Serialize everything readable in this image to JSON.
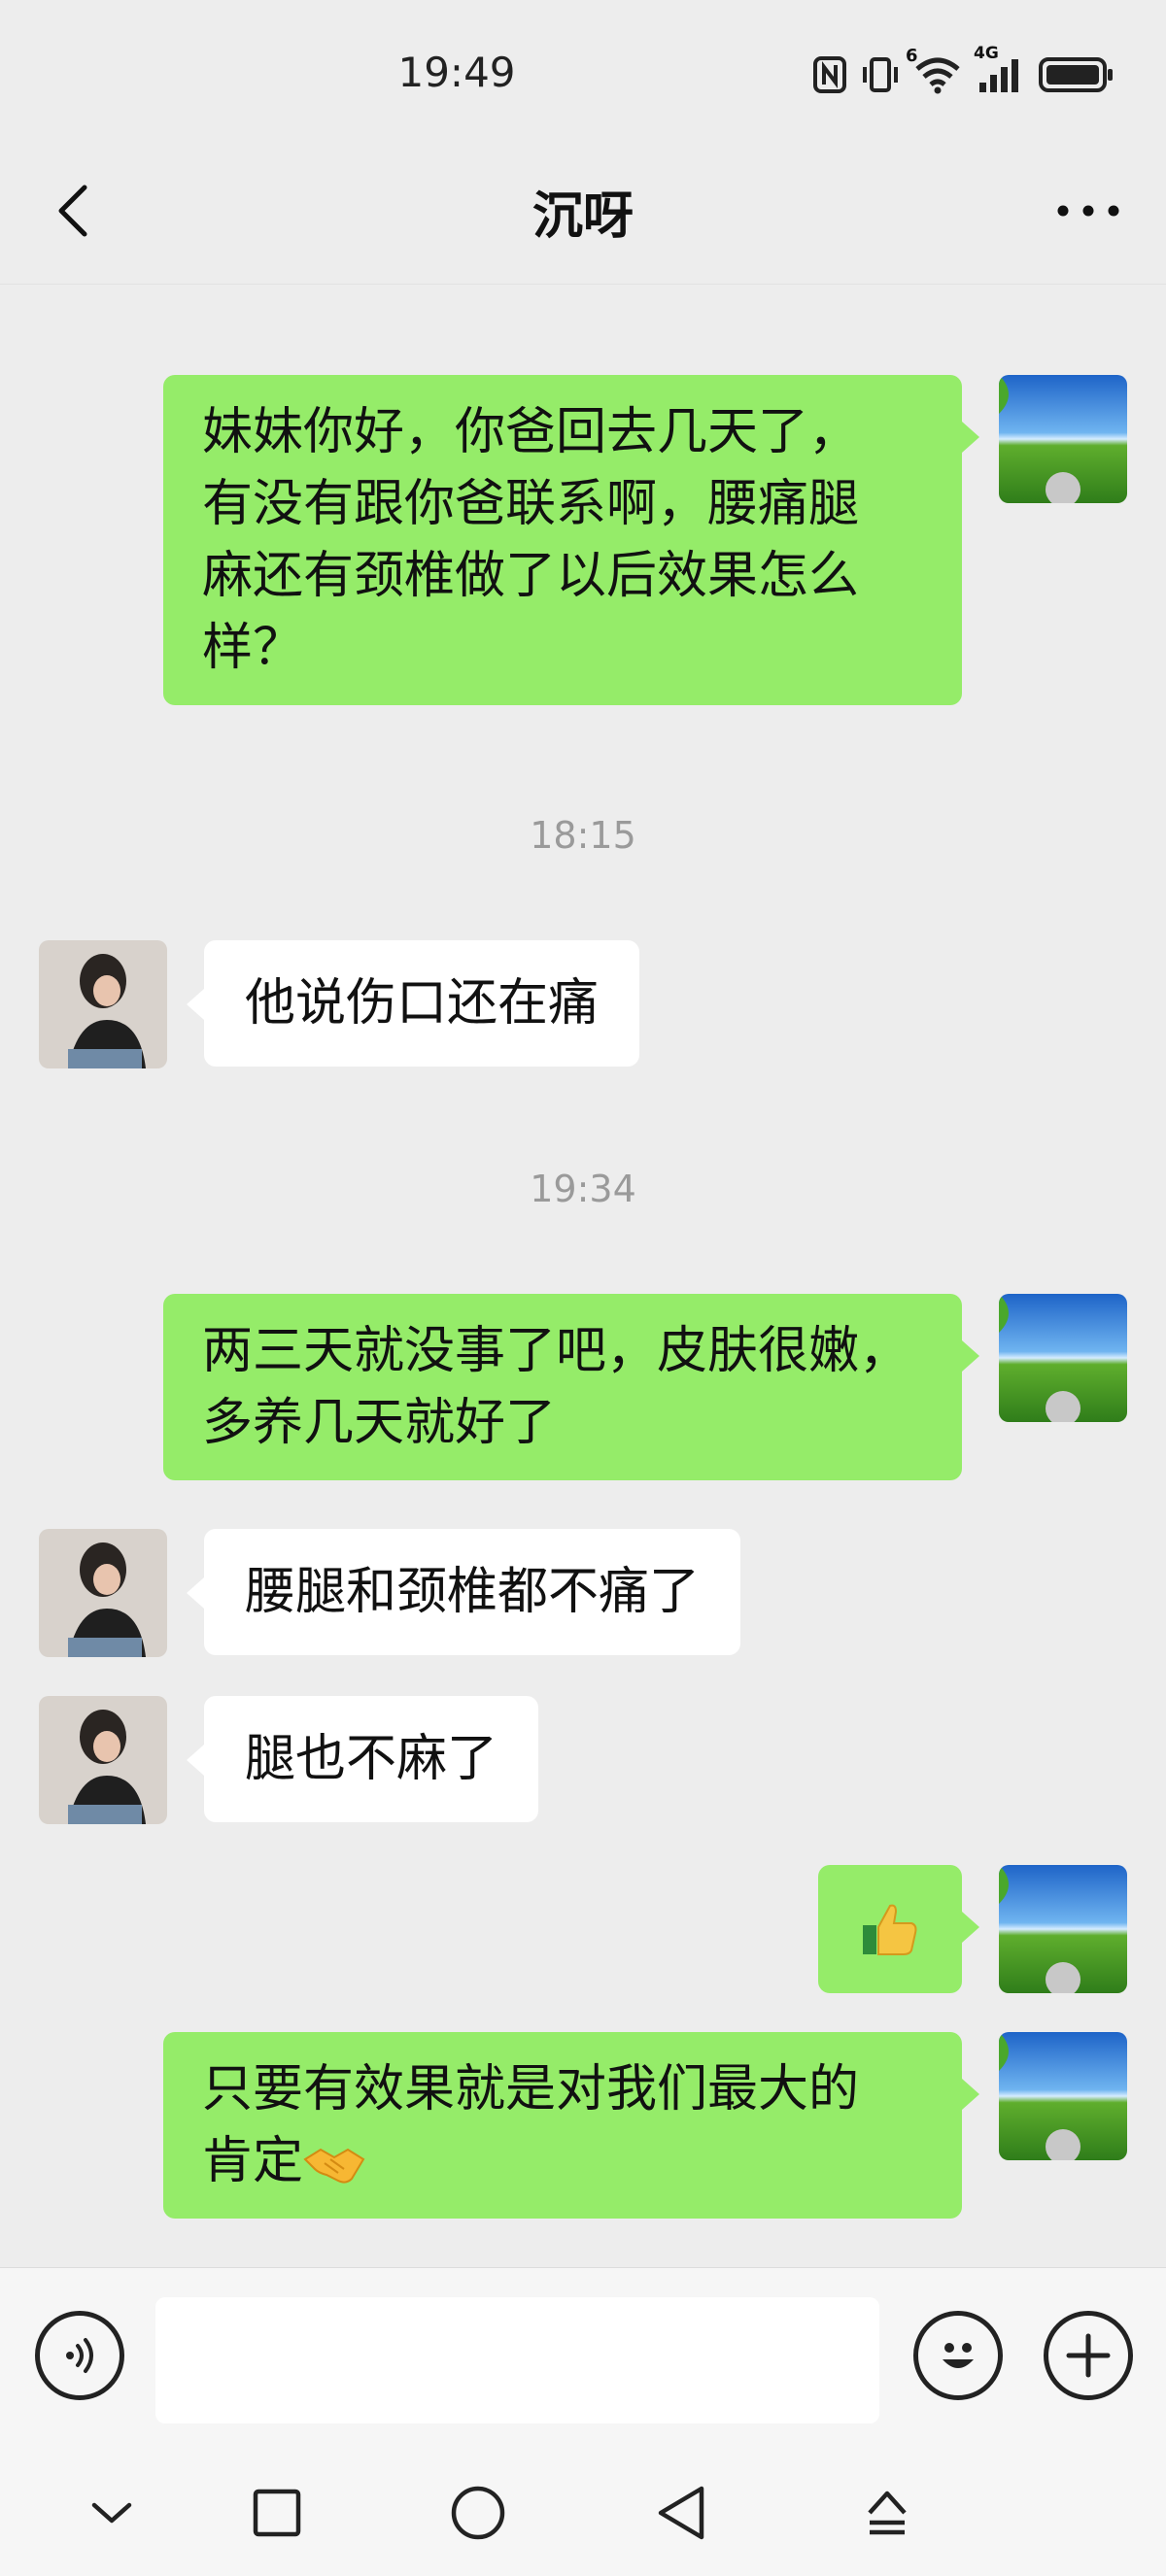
{
  "status_bar": {
    "time": "19:49",
    "icons": [
      "nfc-icon",
      "vibrate-icon",
      "wifi-icon",
      "signal-4g-icon",
      "battery-icon"
    ],
    "wifi_label": "6",
    "network_label": "4G"
  },
  "header": {
    "title": "沉呀",
    "back_icon": "chevron-left-icon",
    "more_icon": "more-dots-icon"
  },
  "messages": [
    {
      "type": "outgoing",
      "text": "妹妹你好，你爸回去几天了，\n有没有跟你爸联系啊，腰痛腿\n麻还有颈椎做了以后效果怎么\n样？"
    },
    {
      "type": "timestamp",
      "text": "18:15"
    },
    {
      "type": "incoming",
      "text": "他说伤口还在痛"
    },
    {
      "type": "timestamp",
      "text": "19:34"
    },
    {
      "type": "outgoing",
      "text": "两三天就没事了吧，皮肤很嫩，\n多养几天就好了"
    },
    {
      "type": "incoming",
      "text": "腰腿和颈椎都不痛了"
    },
    {
      "type": "incoming",
      "text": "腿也不麻了"
    },
    {
      "type": "outgoing",
      "emoji": "thumbs-up-emoji"
    },
    {
      "type": "outgoing",
      "text": "只要有效果就是对我们最大的\n肯定",
      "trailing_emoji": "handshake-emoji"
    }
  ],
  "input_bar": {
    "voice_icon": "voice-icon",
    "emoji_icon": "smiley-icon",
    "plus_icon": "plus-icon",
    "placeholder": ""
  },
  "nav_bar": {
    "icons": [
      "chevron-down-icon",
      "square-icon",
      "circle-icon",
      "triangle-back-icon",
      "eject-icon"
    ]
  },
  "colors": {
    "background": "#ededed",
    "outgoing_bubble": "#95ec69",
    "incoming_bubble": "#ffffff",
    "timestamp_text": "#9a9a9a"
  }
}
